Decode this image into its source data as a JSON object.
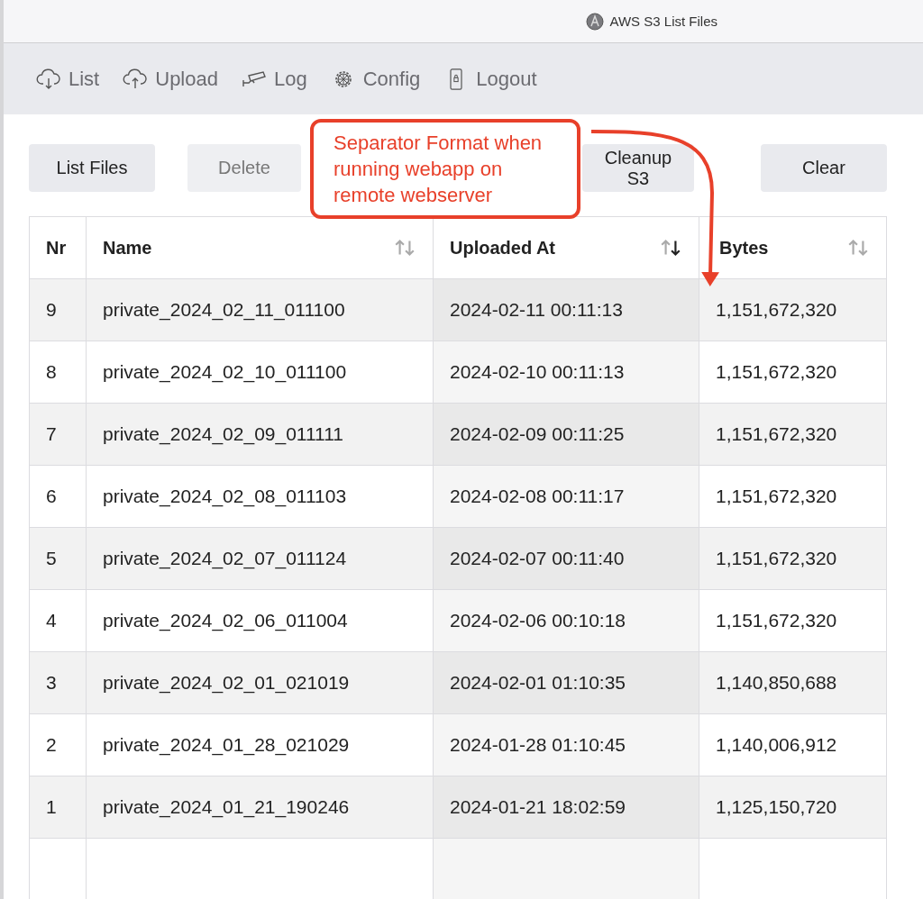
{
  "window": {
    "title": "AWS S3 List Files"
  },
  "nav": [
    {
      "label": "List"
    },
    {
      "label": "Upload"
    },
    {
      "label": "Log"
    },
    {
      "label": "Config"
    },
    {
      "label": "Logout"
    }
  ],
  "buttons": [
    {
      "label": "List Files",
      "disabled": false
    },
    {
      "label": "Delete",
      "disabled": true
    },
    {
      "label": "Cleanup S3",
      "disabled": false
    },
    {
      "label": "Clear",
      "disabled": false
    }
  ],
  "annotation": {
    "text": "Separator Format when running webapp on remote webserver"
  },
  "table": {
    "columns": [
      {
        "label": "Nr",
        "sortable": false,
        "sorted": false
      },
      {
        "label": "Name",
        "sortable": true,
        "sorted": false
      },
      {
        "label": "Uploaded At",
        "sortable": true,
        "sorted": true
      },
      {
        "label": "Bytes",
        "sortable": true,
        "sorted": false
      }
    ],
    "rows": [
      [
        "9",
        "private_2024_02_11_011100",
        "2024-02-11 00:11:13",
        "1,151,672,320"
      ],
      [
        "8",
        "private_2024_02_10_011100",
        "2024-02-10 00:11:13",
        "1,151,672,320"
      ],
      [
        "7",
        "private_2024_02_09_011111",
        "2024-02-09 00:11:25",
        "1,151,672,320"
      ],
      [
        "6",
        "private_2024_02_08_011103",
        "2024-02-08 00:11:17",
        "1,151,672,320"
      ],
      [
        "5",
        "private_2024_02_07_011124",
        "2024-02-07 00:11:40",
        "1,151,672,320"
      ],
      [
        "4",
        "private_2024_02_06_011004",
        "2024-02-06 00:10:18",
        "1,151,672,320"
      ],
      [
        "3",
        "private_2024_02_01_021019",
        "2024-02-01 01:10:35",
        "1,140,850,688"
      ],
      [
        "2",
        "private_2024_01_28_021029",
        "2024-01-28 01:10:45",
        "1,140,006,912"
      ],
      [
        "1",
        "private_2024_01_21_190246",
        "2024-01-21 18:02:59",
        "1,125,150,720"
      ]
    ]
  }
}
